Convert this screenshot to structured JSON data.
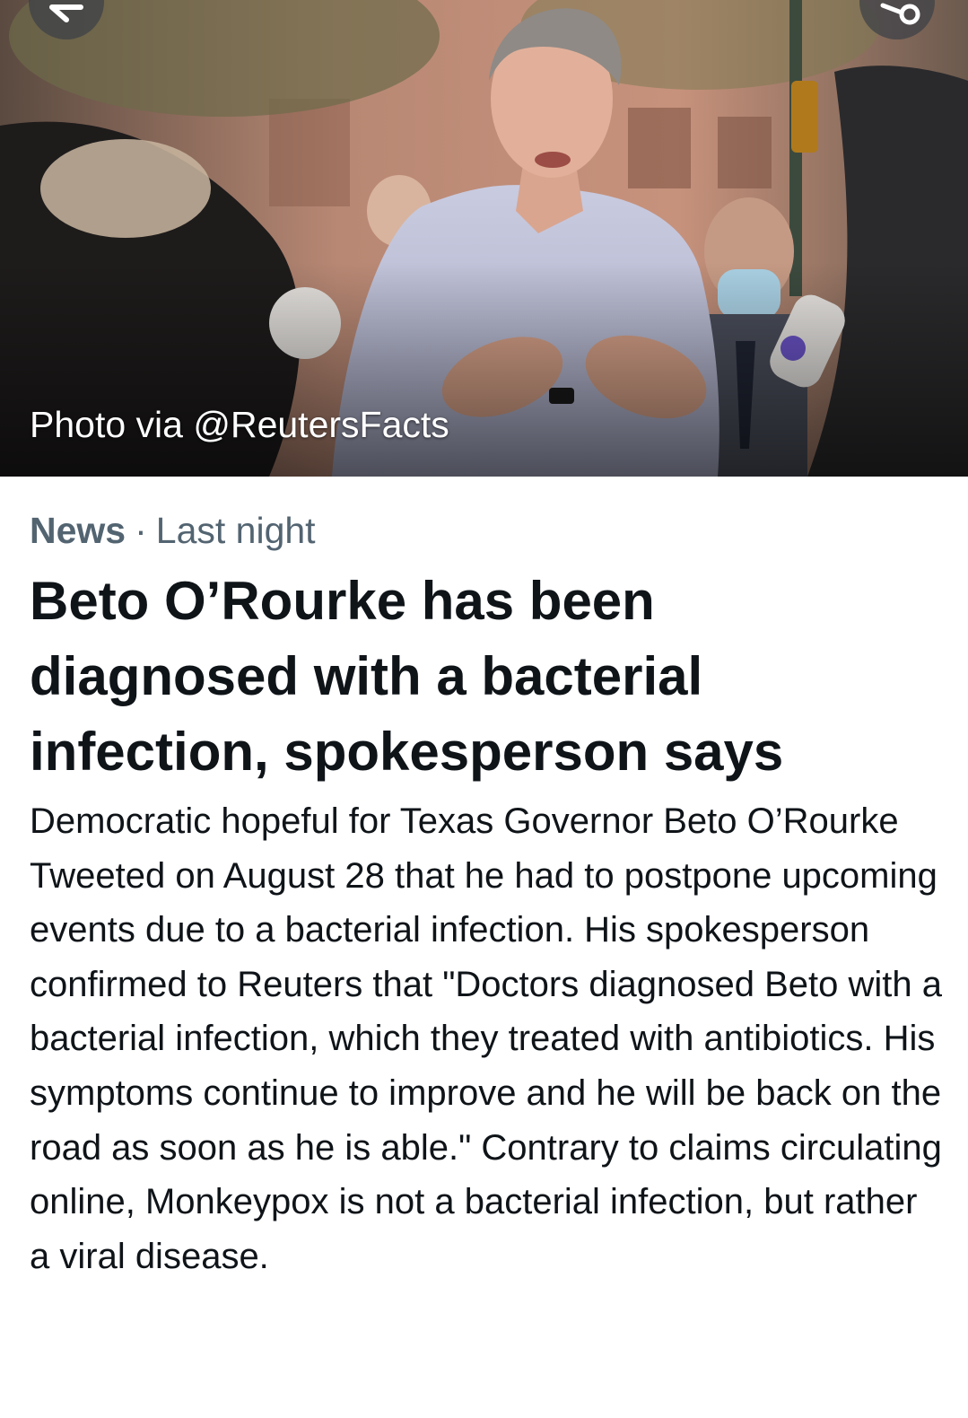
{
  "hero": {
    "caption": "Photo via @ReutersFacts",
    "back_icon": "back-arrow-icon",
    "share_icon": "share-icon"
  },
  "article": {
    "category": "News",
    "separator": "·",
    "time": "Last night",
    "headline": "Beto O’Rourke has been diagnosed with a bacterial infection, spokesperson says",
    "body": "Democratic hopeful for Texas Governor Beto O’Rourke Tweeted on August 28 that he had to postpone upcoming events due to a bacterial infection. His spokesperson confirmed to Reuters that \"Doctors diagnosed Beto with a bacterial infection, which they treated with antibiotics. His symptoms continue to improve and he will be back on the road as soon as he is able.\" Contrary to claims circulating online, Monkeypox is not a bacterial infection, but rather a viral disease."
  },
  "colors": {
    "headline": "#0f1419",
    "secondary": "#536471",
    "background": "#ffffff"
  }
}
